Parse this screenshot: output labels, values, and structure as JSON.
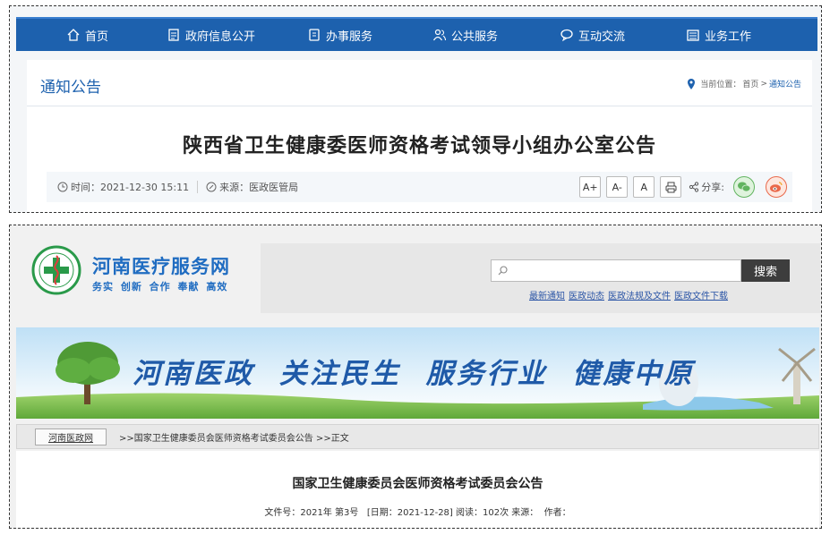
{
  "panel1": {
    "nav": [
      {
        "icon": "home-icon",
        "label": "首页"
      },
      {
        "icon": "document-icon",
        "label": "政府信息公开"
      },
      {
        "icon": "clipboard-icon",
        "label": "办事服务"
      },
      {
        "icon": "people-icon",
        "label": "公共服务"
      },
      {
        "icon": "chat-icon",
        "label": "互动交流"
      },
      {
        "icon": "folder-icon",
        "label": "业务工作"
      }
    ],
    "section_title": "通知公告",
    "location": {
      "label": "当前位置：",
      "home": "首页",
      "sep": ">",
      "current": "通知公告"
    },
    "article_title": "陕西省卫生健康委医师资格考试领导小组办公室公告",
    "meta": {
      "time": "时间：2021-12-30 15:11",
      "source": "来源：医政医管局"
    },
    "font_buttons": [
      "A+",
      "A-",
      "A"
    ],
    "share_label": "分享:"
  },
  "panel2": {
    "site_name": "河南医疗服务网",
    "slogan": "务实 创新 合作 奉献 高效",
    "search": {
      "placeholder": "",
      "button": "搜索"
    },
    "search_links": [
      "最新通知",
      "医政动态",
      "医政法规及文件",
      "医政文件下载"
    ],
    "banner_text": "河南医政 关注民生 服务行业 健康中原",
    "breadcrumb": {
      "home": "河南医政网",
      "path": ">>国家卫生健康委员会医师资格考试委员会公告 >>正文"
    },
    "article_title": "国家卫生健康委员会医师资格考试委员会公告",
    "article_meta": "文件号：2021年 第3号   [日期：2021-12-28] 阅读：102次 来源：  作者："
  },
  "colors": {
    "nav_blue": "#1d61ae",
    "site_blue": "#1f6cc1",
    "wechat_green": "#62b460",
    "weibo_red": "#e9684a"
  }
}
